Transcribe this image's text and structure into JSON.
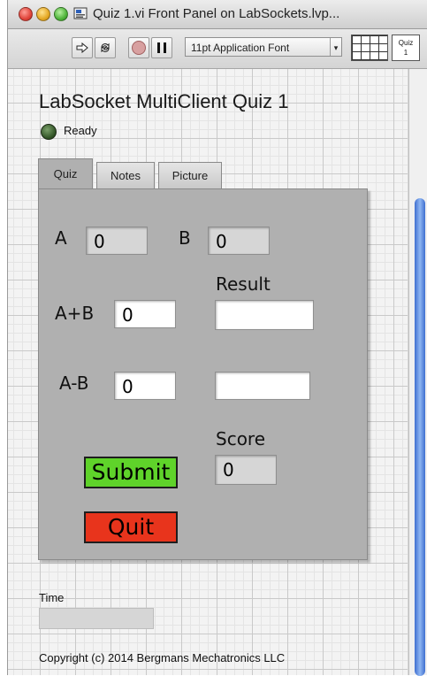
{
  "window": {
    "title": "Quiz 1.vi Front Panel on LabSockets.lvp..."
  },
  "toolbar": {
    "font_selector": "11pt Application Font",
    "quiz_badge_line1": "Quiz",
    "quiz_badge_line2": "1"
  },
  "panel": {
    "title": "LabSocket MultiClient Quiz 1",
    "status_text": "Ready",
    "tabs": [
      {
        "label": "Quiz"
      },
      {
        "label": "Notes"
      },
      {
        "label": "Picture"
      }
    ]
  },
  "quiz": {
    "a_label": "A",
    "a_value": "0",
    "b_label": "B",
    "b_value": "0",
    "result_label": "Result",
    "sum_label": "A+B",
    "sum_value": "0",
    "sum_result": "",
    "diff_label": "A-B",
    "diff_value": "0",
    "diff_result": "",
    "score_label": "Score",
    "score_value": "0",
    "submit_label": "Submit",
    "quit_label": "Quit"
  },
  "footer": {
    "time_label": "Time",
    "copyright": "Copyright (c) 2014 Bergmans Mechatronics LLC"
  },
  "colors": {
    "submit": "#5fd32a",
    "quit": "#e8341c",
    "tab_body": "#b0b0b0"
  }
}
